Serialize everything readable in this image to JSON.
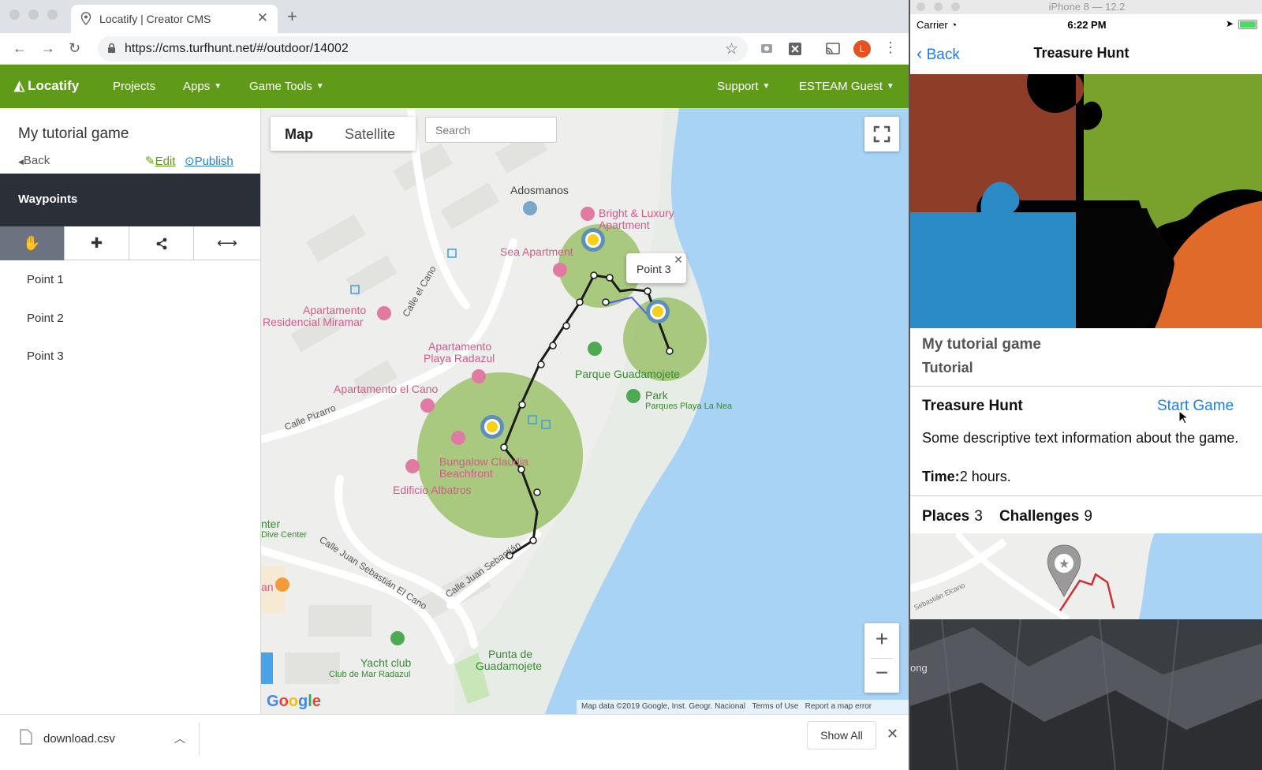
{
  "browser": {
    "tab_title": "Locatify | Creator CMS",
    "url": "https://cms.turfhunt.net/#/outdoor/14002",
    "profile_initial": "L"
  },
  "app_nav": {
    "logo": "Locatify",
    "items": [
      "Projects",
      "Apps",
      "Game Tools"
    ],
    "right_items": [
      "Support",
      "ESTEAM Guest"
    ]
  },
  "sidebar": {
    "game_title": "My tutorial game",
    "back": "Back",
    "edit": "Edit",
    "publish": "Publish",
    "section": "Waypoints",
    "tools": [
      "hand-icon",
      "plus-icon",
      "share-icon",
      "arrows-horizontal-icon"
    ],
    "points": [
      "Point 1",
      "Point 2",
      "Point 3"
    ]
  },
  "map": {
    "type_map": "Map",
    "type_satellite": "Satellite",
    "search_placeholder": "Search",
    "popup": "Point 3",
    "labels": {
      "adosmanos": "Adosmanos",
      "bright1": "Bright & Luxury",
      "bright2": "Apartment",
      "sea": "Sea Apartment",
      "apres1": "Apartamento",
      "apres2": "Residencial Miramar",
      "playa1": "Apartamento",
      "playa2": "Playa Radazul",
      "elcano": "Apartamento el Cano",
      "bungalow1": "Bungalow Claudia",
      "bungalow2": "Beachfront",
      "albatros": "Edificio Albatros",
      "parque": "Parque Guadamojete",
      "park": "Park",
      "parques": "Parques Playa La Nea",
      "center1": "nter",
      "center2": "Dive Center",
      "yacht1": "Yacht club",
      "yacht2": "Club de Mar Radazul",
      "punta1": "Punta de",
      "punta2": "Guadamojete",
      "calle_cano": "Calle el Cano",
      "calle_pizarro": "Calle Pizarro",
      "calle_juan1": "Calle Juan Sebastián El Cano",
      "calle_juan2": "Calle Juan Sebastián",
      "an": "an"
    },
    "google": "Google",
    "attribution": [
      "Map data ©2019 Google, Inst. Geogr. Nacional",
      "Terms of Use",
      "Report a map error"
    ]
  },
  "downloads": {
    "file": "download.csv",
    "show_all": "Show All"
  },
  "phone": {
    "sim_title": "iPhone 8 — 12.2",
    "carrier": "Carrier",
    "time": "6:22 PM",
    "back": "Back",
    "title": "Treasure Hunt",
    "game_title": "My tutorial game",
    "game_subtitle": "Tutorial",
    "hunt_label": "Treasure Hunt",
    "start": "Start Game",
    "description": "Some descriptive text information about the game.",
    "time_label": "Time:",
    "time_value": "2 hours.",
    "places_label": "Places",
    "places_value": "3",
    "challenges_label": "Challenges",
    "challenges_value": "9",
    "minimap_street": "Sebastián Elcano",
    "desktop_text": "ong"
  },
  "colors": {
    "nav_green": "#5f9b19",
    "sidebar_dark": "#2a2f38",
    "water": "#a9d3f5",
    "ios_blue": "#1a7ef2"
  }
}
